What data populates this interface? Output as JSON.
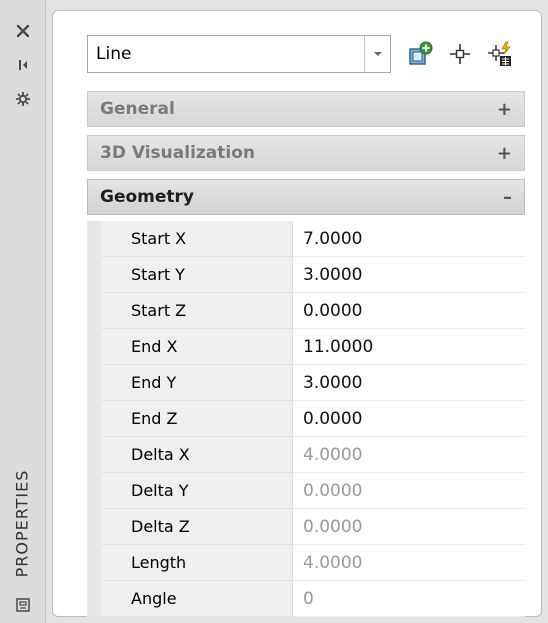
{
  "palette": {
    "strip_bg": "#dcdcdc",
    "panel_bg": "#ffffff",
    "header_bg": "#d6d6d6",
    "label_bg": "#efefef",
    "readonly_text": "#9a9a9a"
  },
  "strip": {
    "close_icon": "close-icon",
    "autohide_icon": "autohide-icon",
    "properties_icon": "properties-gear-icon",
    "title": "PROPERTIES",
    "palette_icon": "palette-icon"
  },
  "toolbar": {
    "object_type": "Line",
    "icons": [
      "toggle-pickadd-icon",
      "select-objects-icon",
      "quick-select-icon"
    ]
  },
  "sections": [
    {
      "name": "General",
      "state": "collapsed",
      "toggle": "+"
    },
    {
      "name": "3D Visualization",
      "state": "collapsed",
      "toggle": "+"
    },
    {
      "name": "Geometry",
      "state": "expanded",
      "toggle": "–"
    }
  ],
  "geometry": [
    {
      "label": "Start X",
      "value": "7.0000",
      "readonly": false
    },
    {
      "label": "Start Y",
      "value": "3.0000",
      "readonly": false
    },
    {
      "label": "Start Z",
      "value": "0.0000",
      "readonly": false
    },
    {
      "label": "End X",
      "value": "11.0000",
      "readonly": false
    },
    {
      "label": "End Y",
      "value": "3.0000",
      "readonly": false
    },
    {
      "label": "End Z",
      "value": "0.0000",
      "readonly": false
    },
    {
      "label": "Delta X",
      "value": "4.0000",
      "readonly": true
    },
    {
      "label": "Delta Y",
      "value": "0.0000",
      "readonly": true
    },
    {
      "label": "Delta Z",
      "value": "0.0000",
      "readonly": true
    },
    {
      "label": "Length",
      "value": "4.0000",
      "readonly": true
    },
    {
      "label": "Angle",
      "value": "0",
      "readonly": true
    }
  ]
}
